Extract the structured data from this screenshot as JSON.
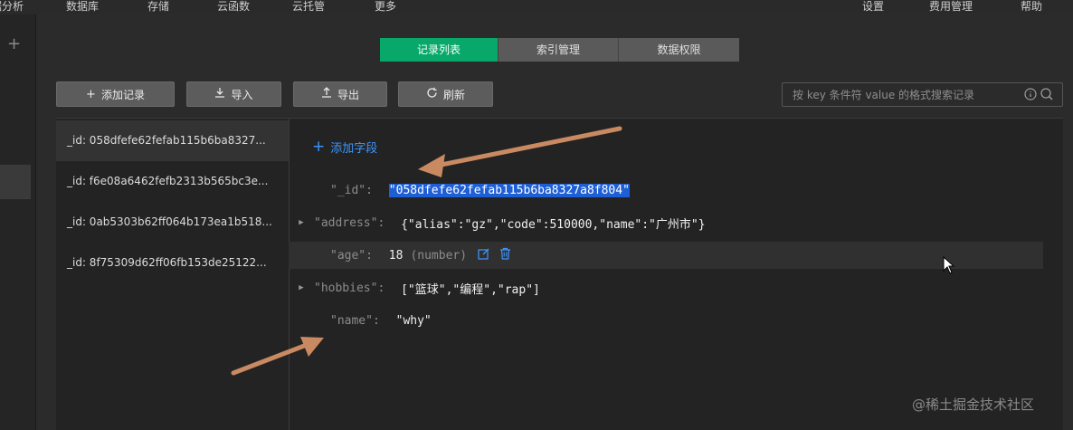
{
  "topbar": {
    "items": [
      "数据分析",
      "数据库",
      "存储",
      "云函数",
      "云托管",
      "更多"
    ],
    "right": [
      "设置",
      "费用管理",
      "帮助"
    ]
  },
  "tabs": [
    "记录列表",
    "索引管理",
    "数据权限"
  ],
  "active_tab": 0,
  "toolbar": {
    "add_record": "添加记录",
    "import": "导入",
    "export": "导出",
    "refresh": "刷新"
  },
  "search": {
    "placeholder": "按 key 条件符 value 的格式搜索记录"
  },
  "records": [
    "_id: 058dfefe62fefab115b6ba8327...",
    "_id: f6e08a6462fefb2313b565bc3e...",
    "_id: 0ab5303b62ff064b173ea1b518...",
    "_id: 8f75309d62ff06fb153de25122..."
  ],
  "selected_record": 0,
  "detail": {
    "add_field": "添加字段",
    "fields": [
      {
        "key": "\"_id\"",
        "value": "\"058dfefe62fefab115b6ba8327a8f804\"",
        "expandable": false
      },
      {
        "key": "\"address\"",
        "value": "{\"alias\":\"gz\",\"code\":510000,\"name\":\"广州市\"}",
        "expandable": true
      },
      {
        "key": "\"age\"",
        "value": "18",
        "type": "(number)",
        "expandable": false
      },
      {
        "key": "\"hobbies\"",
        "value": "[\"篮球\",\"编程\",\"rap\"]",
        "expandable": true
      },
      {
        "key": "\"name\"",
        "value": "\"why\"",
        "expandable": false
      }
    ]
  },
  "watermark": "@稀土掘金技术社区",
  "colors": {
    "accent": "#07a86a",
    "link": "#3c96ff",
    "selection": "#1f5fd6",
    "annotation_arrow": "#c98a62"
  }
}
